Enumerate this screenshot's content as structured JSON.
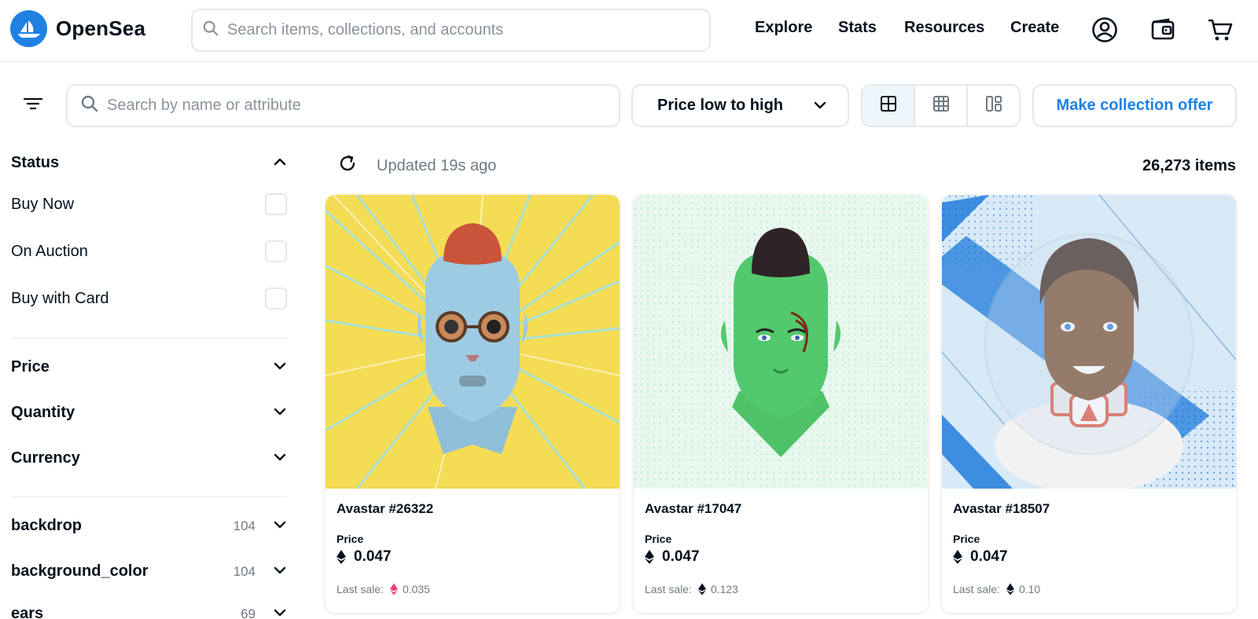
{
  "header": {
    "brand": "OpenSea",
    "search_placeholder": "Search items, collections, and accounts",
    "nav": [
      "Explore",
      "Stats",
      "Resources",
      "Create"
    ],
    "icons": [
      "profile-icon",
      "wallet-icon",
      "cart-icon"
    ]
  },
  "toolbar": {
    "filter_search_placeholder": "Search by name or attribute",
    "sort_label": "Price low to high",
    "views": [
      "large-grid-icon",
      "small-grid-icon",
      "mosaic-icon"
    ],
    "offer_button": "Make collection offer"
  },
  "sidebar": {
    "status_title": "Status",
    "status_options": [
      "Buy Now",
      "On Auction",
      "Buy with Card"
    ],
    "sections": [
      {
        "label": "Price"
      },
      {
        "label": "Quantity"
      },
      {
        "label": "Currency"
      }
    ],
    "traits": [
      {
        "label": "backdrop",
        "count": "104"
      },
      {
        "label": "background_color",
        "count": "104"
      },
      {
        "label": "ears",
        "count": "69"
      }
    ]
  },
  "results": {
    "updated": "Updated 19s ago",
    "count": "26,273 items",
    "cards": [
      {
        "name": "Avastar #26322",
        "price_label": "Price",
        "price": "0.047",
        "last_sale_label": "Last sale:",
        "last_sale": "0.035",
        "last_sale_token": "weth"
      },
      {
        "name": "Avastar #17047",
        "price_label": "Price",
        "price": "0.047",
        "last_sale_label": "Last sale:",
        "last_sale": "0.123",
        "last_sale_token": "eth"
      },
      {
        "name": "Avastar #18507",
        "price_label": "Price",
        "price": "0.047",
        "last_sale_label": "Last sale:",
        "last_sale": "0.10",
        "last_sale_token": "eth"
      }
    ]
  },
  "colors": {
    "brand": "#2081e2",
    "border": "#e5e8eb",
    "muted": "#707a83",
    "weth": "#ec407a"
  }
}
